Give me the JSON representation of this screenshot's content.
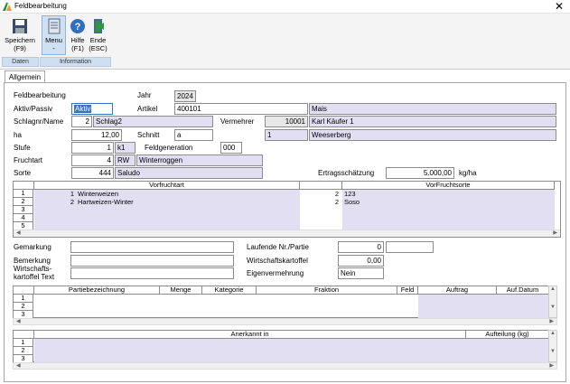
{
  "window": {
    "title": "Feldbearbeitung",
    "close_glyph": "✕"
  },
  "ribbon": {
    "buttons": [
      {
        "label": "Speichern",
        "sub": "(F9)",
        "icon": "save-icon"
      },
      {
        "label": "Menu",
        "sub": "-",
        "icon": "menu-icon"
      },
      {
        "label": "Hilfe",
        "sub": "(F1)",
        "icon": "help-icon"
      },
      {
        "label": "Ende",
        "sub": "(ESC)",
        "icon": "exit-icon"
      }
    ],
    "groups": [
      "Daten",
      "Information"
    ]
  },
  "tab": "Allgemein",
  "form": {
    "section_title": "Feldbearbeitung",
    "jahr_label": "Jahr",
    "jahr": "2024",
    "aktiv_label": "Aktiv/Passiv",
    "aktiv": "Aktiv",
    "artikel_label": "Artikel",
    "artikel_nr": "400101",
    "artikel_name": "Mais",
    "schlag_label": "Schlagnr/Name",
    "schlag_nr": "2",
    "schlag_name": "Schlag2",
    "vermehrer_label": "Vermehrer",
    "vermehrer_nr": "10001",
    "vermehrer_name": "Karl Käufer 1",
    "ha_label": "ha",
    "ha": "12,00",
    "schnitt_label": "Schnitt",
    "schnitt": "a",
    "ort_nr": "1",
    "ort_name": "Weeserberg",
    "stufe_label": "Stufe",
    "stufe_nr": "1",
    "stufe_code": "k1",
    "feldgen_label": "Feldgeneration",
    "feldgen": "000",
    "fruchtart_label": "Fruchtart",
    "fruchtart_nr": "4",
    "fruchtart_code": "RW",
    "fruchtart_name": "Winterroggen",
    "sorte_label": "Sorte",
    "sorte_nr": "444",
    "sorte_name": "Saludo",
    "ertrag_label": "Ertragsschätzung",
    "ertrag": "5.000,00",
    "ertrag_unit": "kg/ha",
    "gemarkung_label": "Gemarkung",
    "gemarkung": "",
    "lfd_label": "Laufende Nr./Partie",
    "lfd_nr": "0",
    "lfd_partie": "",
    "bemerkung_label": "Bemerkung",
    "bemerkung": "",
    "wk_label": "Wirtschaftskartoffel",
    "wk": "0,00",
    "wkt_label_1": "Wirtschafts-",
    "wkt_label_2": "kartoffel Text",
    "wkt": "",
    "eigen_label": "Eigenvermehrung",
    "eigen": "Nein"
  },
  "vorfrucht_table": {
    "headers": [
      "Vorfruchtart",
      "VorFruchtsorte"
    ],
    "rows": [
      {
        "n": "1",
        "art_nr": "1",
        "art": "Winterweizen",
        "sorte_nr": "2",
        "sorte": "123"
      },
      {
        "n": "2",
        "art_nr": "2",
        "art": "Hartweizen-Winter",
        "sorte_nr": "2",
        "sorte": "Soso"
      },
      {
        "n": "3",
        "art_nr": "",
        "art": "",
        "sorte_nr": "",
        "sorte": ""
      },
      {
        "n": "4",
        "art_nr": "",
        "art": "",
        "sorte_nr": "",
        "sorte": ""
      },
      {
        "n": "5",
        "art_nr": "",
        "art": "",
        "sorte_nr": "",
        "sorte": ""
      }
    ]
  },
  "partie_table": {
    "headers": [
      "Partiebezeichnung",
      "Menge",
      "Kategorie",
      "Fraktion",
      "Feld",
      "Auftrag",
      "Auf.Datum"
    ],
    "rows": [
      "1",
      "2",
      "3"
    ]
  },
  "anerkannt_table": {
    "headers": [
      "Anerkannt in",
      "Aufteilung (kg)"
    ],
    "rows": [
      "1",
      "2",
      "3"
    ]
  },
  "colors": {
    "accent": "#e2dff3",
    "ribbon_group": "#cfdff0"
  }
}
